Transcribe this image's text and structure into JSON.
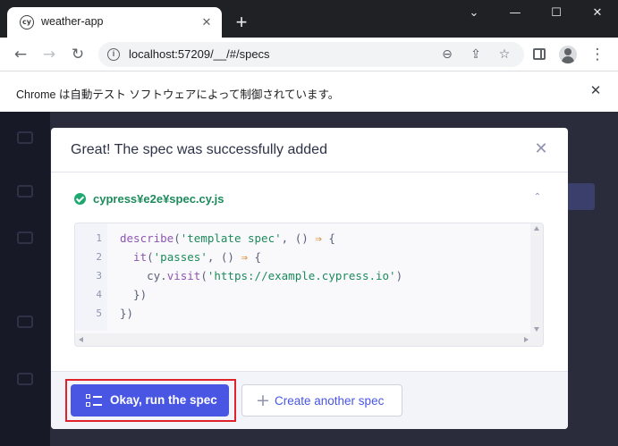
{
  "browser": {
    "tab": {
      "favicon_text": "cy",
      "title": "weather-app",
      "close_glyph": "✕"
    },
    "new_tab_glyph": "+",
    "window_controls": {
      "minimize": "⌄",
      "restore": "—",
      "maximize": "☐",
      "close": "✕"
    },
    "nav": {
      "back": "←",
      "forward": "→",
      "reload": "↻"
    },
    "address": {
      "url": "localhost:57209/__/#/specs",
      "info_glyph": "i"
    },
    "omnibox_icons": {
      "zoom": "⊖",
      "share": "⇪",
      "star": "☆"
    },
    "menu_glyph": "⋮",
    "infobar": {
      "text": "Chrome は自動テスト ソフトウェアによって制御されています。",
      "close_glyph": "✕"
    }
  },
  "modal": {
    "title": "Great! The spec was successfully added",
    "close_glyph": "✕",
    "file": {
      "name": "cypress¥e2e¥spec.cy.js",
      "collapse_glyph": "⌃"
    },
    "code": {
      "line_numbers": [
        "1",
        "2",
        "3",
        "4",
        "5"
      ],
      "lines": [
        [
          {
            "t": "describe",
            "c": "fn"
          },
          {
            "t": "(",
            "c": "plain"
          },
          {
            "t": "'template spec'",
            "c": "str"
          },
          {
            "t": ", () ",
            "c": "plain"
          },
          {
            "t": "⇒",
            "c": "arrow"
          },
          {
            "t": " {",
            "c": "plain"
          }
        ],
        [
          {
            "t": "  it",
            "c": "fn"
          },
          {
            "t": "(",
            "c": "plain"
          },
          {
            "t": "'passes'",
            "c": "str"
          },
          {
            "t": ", () ",
            "c": "plain"
          },
          {
            "t": "⇒",
            "c": "arrow"
          },
          {
            "t": " {",
            "c": "plain"
          }
        ],
        [
          {
            "t": "    cy.",
            "c": "plain"
          },
          {
            "t": "visit",
            "c": "fn"
          },
          {
            "t": "(",
            "c": "plain"
          },
          {
            "t": "'https://example.cypress.io'",
            "c": "str"
          },
          {
            "t": ")",
            "c": "plain"
          }
        ],
        [
          {
            "t": "  })",
            "c": "plain"
          }
        ],
        [
          {
            "t": "})",
            "c": "plain"
          }
        ]
      ]
    },
    "buttons": {
      "primary": "Okay, run the spec",
      "secondary": "Create another spec",
      "secondary_icon": "+"
    }
  },
  "colors": {
    "accent": "#4956e3",
    "success": "#1fa971",
    "highlight": "#e0232a"
  }
}
